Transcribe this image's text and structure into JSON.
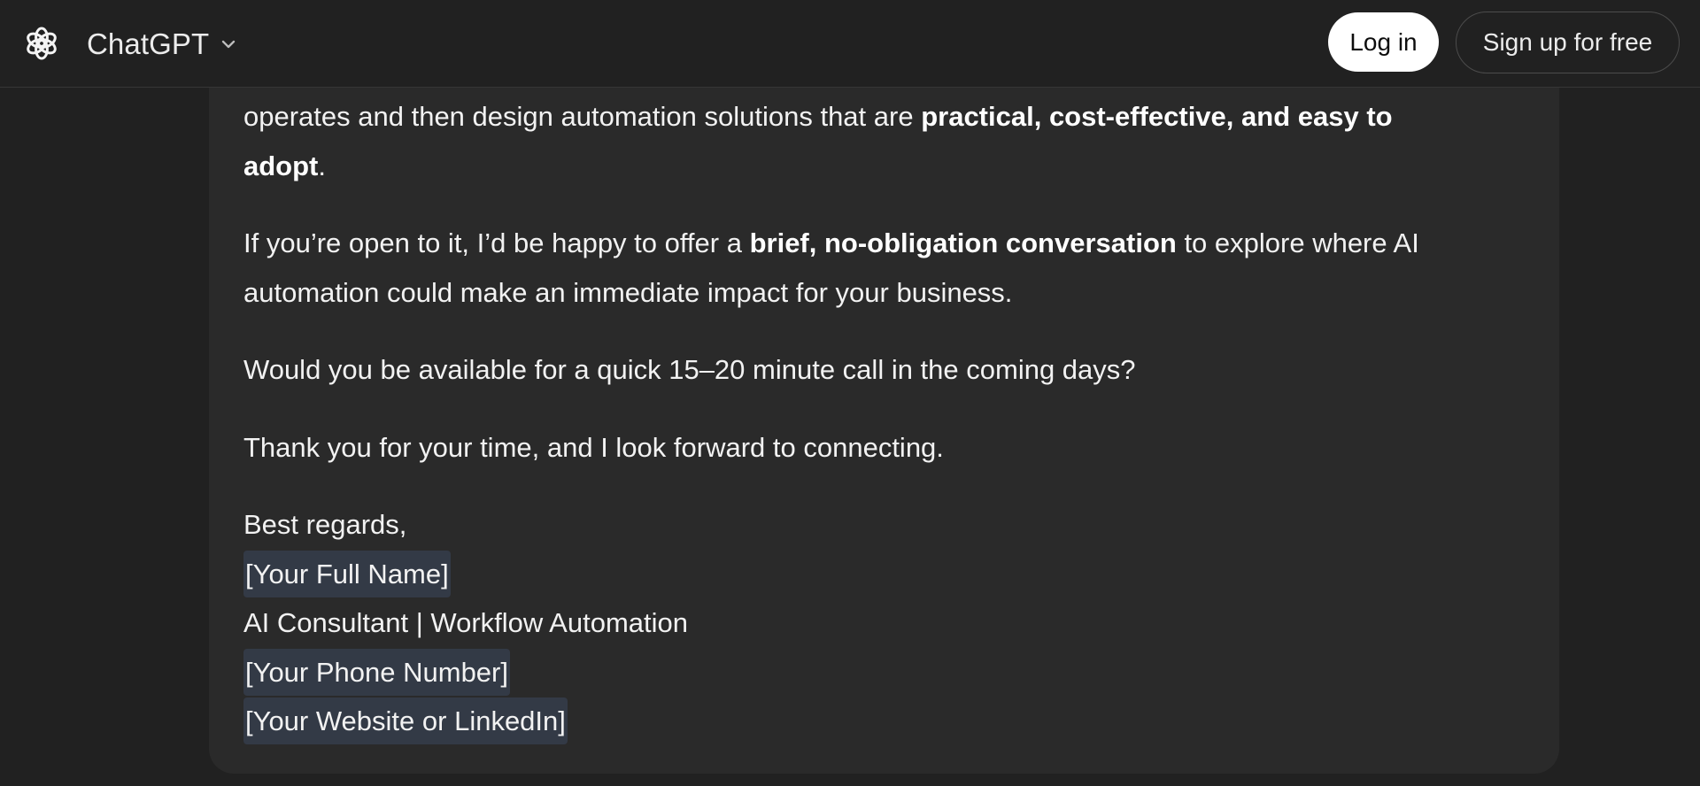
{
  "header": {
    "brand_name": "ChatGPT",
    "logo_icon": "openai-logo-icon",
    "switcher_icon": "chevron-down-icon",
    "login_label": "Log in",
    "signup_label": "Sign up for free"
  },
  "message": {
    "p1_part1": "operates and then design automation solutions that are ",
    "p1_bold": "practical, cost-effective, and easy to",
    "p1_line2_bold": "adopt",
    "p1_end": ".",
    "p2_part1": "If you’re open to it, I’d be happy to offer a ",
    "p2_bold": "brief, no-obligation conversation",
    "p2_part2": " to explore where AI",
    "p2_line2": "automation could make an immediate impact for your business.",
    "p3": "Would you be available for a quick 15–20 minute call in the coming days?",
    "p4": "Thank you for your time, and I look forward to connecting.",
    "signature": {
      "closing": "Best regards,",
      "name_placeholder": "[Your Full Name]",
      "title": "AI Consultant | Workflow Automation",
      "phone_placeholder": "[Your Phone Number]",
      "website_placeholder": "[Your Website or LinkedIn]"
    }
  },
  "colors": {
    "page_background": "#212121",
    "card_background": "#2a2a2a",
    "placeholder_highlight": "#333a46",
    "primary_text": "#ececec",
    "login_background": "#ffffff"
  }
}
